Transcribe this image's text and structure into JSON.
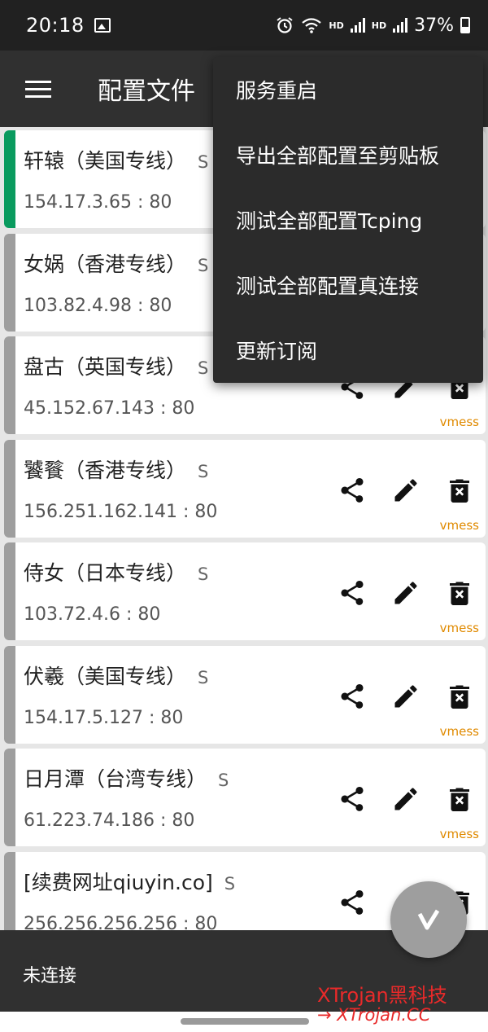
{
  "status_bar": {
    "time": "20:18",
    "hd1": "HD",
    "hd2": "HD",
    "battery": "37%",
    "icons": [
      "image-icon",
      "alarm-icon",
      "wifi-icon",
      "signal-icon",
      "signal-icon",
      "battery-icon"
    ]
  },
  "toolbar": {
    "title": "配置文件",
    "menu_icon": "hamburger-menu-icon"
  },
  "servers": [
    {
      "name": "轩辕（美国专线）",
      "sub": "S",
      "address": "154.17.3.65 : 80",
      "type": "",
      "active": true
    },
    {
      "name": "女娲（香港专线）",
      "sub": "S",
      "address": "103.82.4.98 : 80",
      "type": "",
      "active": false
    },
    {
      "name": "盘古（英国专线）",
      "sub": "S",
      "address": "45.152.67.143 : 80",
      "type": "vmess",
      "active": false
    },
    {
      "name": "饕餮（香港专线）",
      "sub": "S",
      "address": "156.251.162.141 : 80",
      "type": "vmess",
      "active": false
    },
    {
      "name": "侍女（日本专线）",
      "sub": "S",
      "address": "103.72.4.6 : 80",
      "type": "vmess",
      "active": false
    },
    {
      "name": "伏羲（美国专线）",
      "sub": "S",
      "address": "154.17.5.127 : 80",
      "type": "vmess",
      "active": false
    },
    {
      "name": "日月潭（台湾专线）",
      "sub": "S",
      "address": "61.223.74.186 : 80",
      "type": "vmess",
      "active": false
    },
    {
      "name": "[续费网址qiuyin.co]",
      "sub": "S",
      "address": "256.256.256.256 : 80",
      "type": "",
      "active": false
    }
  ],
  "menu": {
    "items": [
      {
        "label": "服务重启"
      },
      {
        "label": "导出全部配置至剪贴板"
      },
      {
        "label": "测试全部配置Tcping"
      },
      {
        "label": "测试全部配置真连接"
      },
      {
        "label": "更新订阅"
      }
    ]
  },
  "bottom": {
    "status": "未连接",
    "watermark_line1": "XTrojan黑科技",
    "watermark_line2": "→ XTrojan.CC"
  },
  "colors": {
    "active": "#0a9b5f",
    "inactive": "#9e9e9e",
    "type": "#e08a00",
    "toolbar": "#303030",
    "watermark": "#e82a2a"
  }
}
